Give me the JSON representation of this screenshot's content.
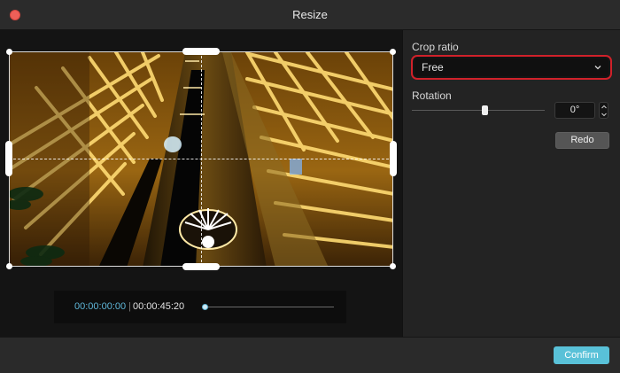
{
  "window": {
    "title": "Resize",
    "close_icon": "close-icon"
  },
  "preview": {
    "image_icon": "video-frame-icon",
    "timecode_current": "00:00:00:00",
    "timecode_separator": "|",
    "timecode_total": "00:00:45:20",
    "playhead_progress": 0
  },
  "settings": {
    "crop_ratio_label": "Crop ratio",
    "crop_ratio_value": "Free",
    "chevron_icon": "chevron-down-icon",
    "rotation_label": "Rotation",
    "rotation_value": "0°",
    "stepper_icons": [
      "chevron-up-icon",
      "chevron-down-icon"
    ],
    "redo_label": "Redo"
  },
  "footer": {
    "confirm_label": "Confirm"
  },
  "colors": {
    "accent": "#59c1d8",
    "highlight_border": "#d0212a",
    "close_dot": "#ee5f58"
  }
}
